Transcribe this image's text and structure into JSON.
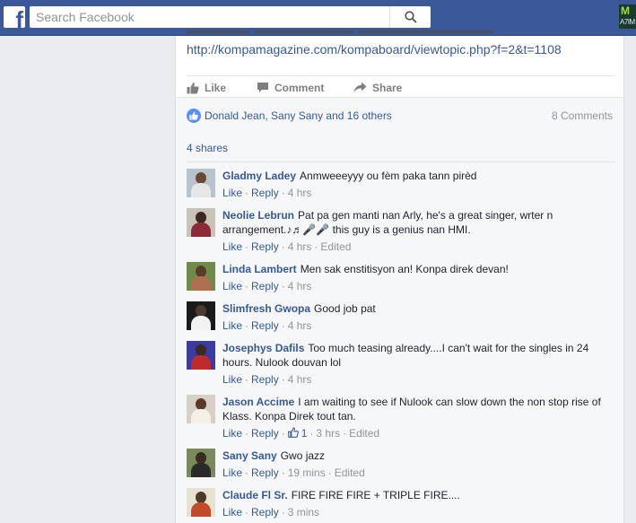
{
  "search": {
    "placeholder": "Search Facebook"
  },
  "corner_thumb": {
    "line1": "M",
    "line2": "A7IM"
  },
  "post": {
    "link": "http://kompamagazine.com/kompaboard/viewtopic.php?f=2&t=1108"
  },
  "actions": {
    "like": "Like",
    "comment": "Comment",
    "share": "Share"
  },
  "reactions": {
    "likers": "Donald Jean, Sany Sany and 16 others",
    "comments_count": "8 Comments",
    "shares": "4 shares"
  },
  "comment_actions": {
    "like": "Like",
    "reply": "Reply"
  },
  "comments": [
    {
      "name": "Gladmy Ladey",
      "text": "Anmweeeyyy ou fèm paka tann pirèd",
      "time": "4 hrs",
      "edited": "",
      "likes": ""
    },
    {
      "name": "Neolie Lebrun",
      "text": "Pat pa gen manti nan Arly, he's a great singer, wrter n arrangement.♪♬🎤🎤 this guy is a genius nan HMI.",
      "time": "4 hrs",
      "edited": "Edited",
      "likes": ""
    },
    {
      "name": "Linda Lambert",
      "text": "Men sak enstitisyon an! Konpa direk devan!",
      "time": "4 hrs",
      "edited": "",
      "likes": ""
    },
    {
      "name": "Slimfresh Gwopa",
      "text": "Good job pat",
      "time": "4 hrs",
      "edited": "",
      "likes": ""
    },
    {
      "name": "Josephys Dafils",
      "text": "Too much teasing already....I can't wait for the singles in 24 hours. Nulook douvan lol",
      "time": "4 hrs",
      "edited": "",
      "likes": ""
    },
    {
      "name": "Jason Accime",
      "text": "I am waiting to see if Nulook can slow down the non stop rise of Klass. Konpa Direk tout tan.",
      "time": "3 hrs",
      "edited": "Edited",
      "likes": "1"
    },
    {
      "name": "Sany Sany",
      "text": "Gwo jazz",
      "time": "19 mins",
      "edited": "Edited",
      "likes": ""
    },
    {
      "name": "Claude Fl Sr.",
      "text": "FIRE FIRE FIRE + TRIPLE FIRE....",
      "time": "3 mins",
      "edited": "",
      "likes": ""
    }
  ],
  "colors": {
    "brand": "#3b5998",
    "link": "#365899",
    "meta": "#90949c",
    "page_bg": "#e9ebee"
  }
}
